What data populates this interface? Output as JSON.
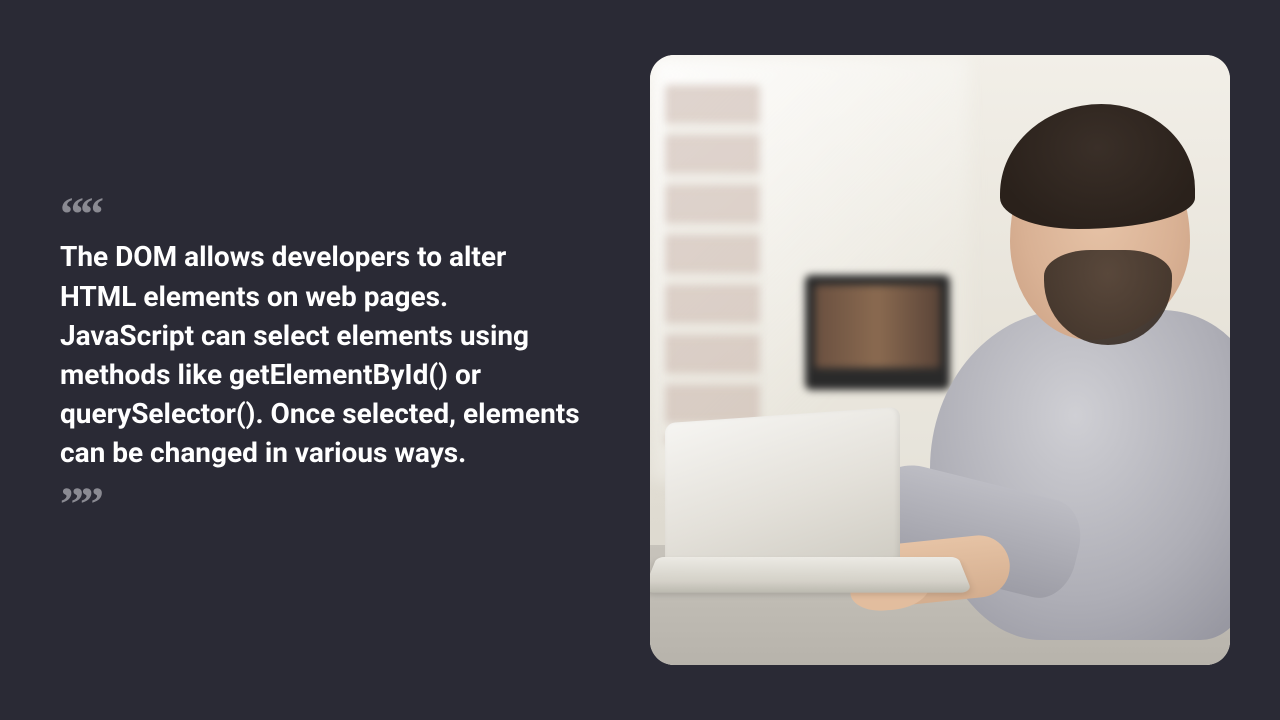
{
  "quote": {
    "open_mark": "““",
    "close_mark": "””",
    "text": "The DOM allows developers to alter HTML elements on web pages. JavaScript can select elements using methods like getElementById() or querySelector(). Once selected, elements can be changed in various ways."
  },
  "image": {
    "alt": "Young man with beard wearing a gray t-shirt, typing on a silver laptop in a bright home-office with bookshelves and a monitor in the background"
  }
}
